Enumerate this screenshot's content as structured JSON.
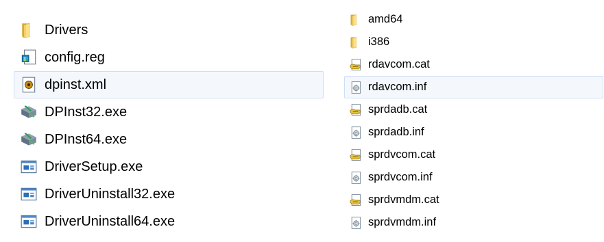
{
  "left_panel": {
    "items": [
      {
        "name": "Drivers",
        "icon": "folder-icon",
        "selected": false
      },
      {
        "name": "config.reg",
        "icon": "registry-file-icon",
        "selected": false
      },
      {
        "name": "dpinst.xml",
        "icon": "xml-file-icon",
        "selected": true
      },
      {
        "name": "DPInst32.exe",
        "icon": "installer-exe-icon",
        "selected": false
      },
      {
        "name": "DPInst64.exe",
        "icon": "installer-exe-icon",
        "selected": false
      },
      {
        "name": "DriverSetup.exe",
        "icon": "application-exe-icon",
        "selected": false
      },
      {
        "name": "DriverUninstall32.exe",
        "icon": "application-exe-icon",
        "selected": false
      },
      {
        "name": "DriverUninstall64.exe",
        "icon": "application-exe-icon",
        "selected": false
      }
    ]
  },
  "right_panel": {
    "items": [
      {
        "name": "amd64",
        "icon": "folder-icon",
        "selected": false
      },
      {
        "name": "i386",
        "icon": "folder-icon",
        "selected": false
      },
      {
        "name": "rdavcom.cat",
        "icon": "security-catalog-icon",
        "selected": false
      },
      {
        "name": "rdavcom.inf",
        "icon": "setup-information-icon",
        "selected": true
      },
      {
        "name": "sprdadb.cat",
        "icon": "security-catalog-icon",
        "selected": false
      },
      {
        "name": "sprdadb.inf",
        "icon": "setup-information-icon",
        "selected": false
      },
      {
        "name": "sprdvcom.cat",
        "icon": "security-catalog-icon",
        "selected": false
      },
      {
        "name": "sprdvcom.inf",
        "icon": "setup-information-icon",
        "selected": false
      },
      {
        "name": "sprdvmdm.cat",
        "icon": "security-catalog-icon",
        "selected": false
      },
      {
        "name": "sprdvmdm.inf",
        "icon": "setup-information-icon",
        "selected": false
      }
    ]
  },
  "colors": {
    "selection_bg": "#f4f8fd",
    "selection_border": "#cfdff2",
    "folder": "#e8c25a"
  }
}
